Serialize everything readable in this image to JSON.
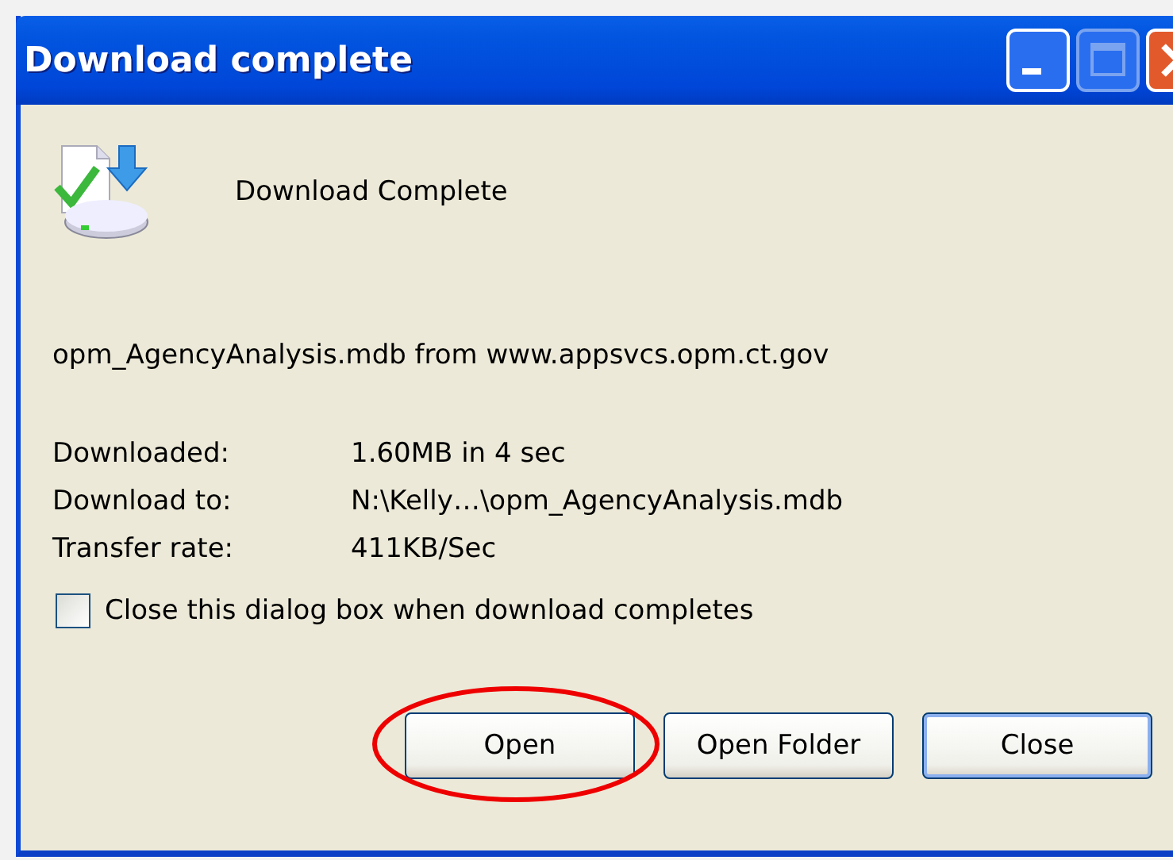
{
  "window": {
    "title": "Download complete"
  },
  "heading": "Download Complete",
  "source": "opm_AgencyAnalysis.mdb from www.appsvcs.opm.ct.gov",
  "details": [
    {
      "label": "Downloaded:",
      "value": "1.60MB in 4 sec"
    },
    {
      "label": "Download to:",
      "value": "N:\\Kelly…\\opm_AgencyAnalysis.mdb"
    },
    {
      "label": "Transfer rate:",
      "value": "411KB/Sec"
    }
  ],
  "close_when_done": {
    "label": "Close this dialog box when download completes",
    "checked": false
  },
  "buttons": [
    {
      "label": "Open",
      "default": false,
      "highlighted": true
    },
    {
      "label": "Open Folder",
      "default": false,
      "highlighted": false
    },
    {
      "label": "Close",
      "default": true,
      "highlighted": false
    }
  ]
}
